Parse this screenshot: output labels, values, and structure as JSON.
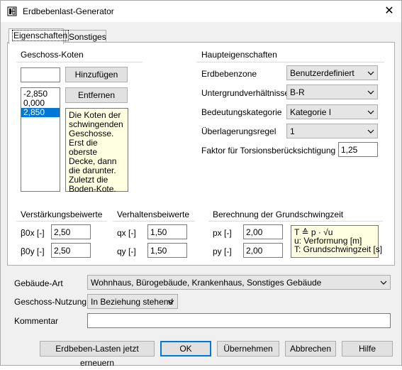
{
  "window": {
    "title": "Erdbebenlast-Generator",
    "close_glyph": "✕"
  },
  "tabs": [
    {
      "label": "Eigenschaften"
    },
    {
      "label": "Sonstiges"
    }
  ],
  "geschoss": {
    "title": "Geschoss-Koten",
    "input_value": "",
    "add_label": "Hinzufügen",
    "remove_label": "Entfernen",
    "items": [
      "-2,850",
      "0,000",
      "2,850"
    ],
    "selected_index": 2,
    "hint": "Die Koten der schwingenden Geschosse. Erst die oberste Decke, dann die darunter. Zuletzt die Boden-Kote."
  },
  "haupt": {
    "title": "Haupteigenschaften",
    "erdbebenzone": {
      "label": "Erdbebenzone",
      "value": "Benutzerdefiniert"
    },
    "untergrund": {
      "label": "Untergrundverhältnisse",
      "value": "B-R"
    },
    "bedeutung": {
      "label": "Bedeutungskategorie",
      "value": "Kategorie I"
    },
    "ueberlagerung": {
      "label": "Überlagerungsregel",
      "value": "1"
    },
    "torsion": {
      "label": "Faktor für Torsionsberücksichtigung [-]",
      "value": "1,25"
    }
  },
  "verstaerkung": {
    "title": "Verstärkungsbeiwerte",
    "b0x": {
      "label": "β0x [-]",
      "value": "2,50"
    },
    "b0y": {
      "label": "β0y [-]",
      "value": "2,50"
    }
  },
  "verhalten": {
    "title": "Verhaltensbeiwerte",
    "qx": {
      "label": "qx [-]",
      "value": "1,50"
    },
    "qy": {
      "label": "qy [-]",
      "value": "1,50"
    }
  },
  "grundschwingzeit": {
    "title": "Berechnung der Grundschwingzeit",
    "px": {
      "label": "px [-]",
      "value": "2,00"
    },
    "py": {
      "label": "py [-]",
      "value": "2,00"
    },
    "formula": "T ≙ p · √u",
    "line2": "u: Verformung [m]",
    "line3": "T: Grundschwingzeit [s]"
  },
  "gebaeude": {
    "label": "Gebäude-Art",
    "value": "Wohnhaus, Bürogebäude, Krankenhaus, Sonstiges Gebäude"
  },
  "nutzung": {
    "label": "Geschoss-Nutzung",
    "value": "In Beziehung stehend"
  },
  "kommentar": {
    "label": "Kommentar",
    "value": ""
  },
  "buttons": {
    "renew": "Erdbeben-Lasten jetzt erneuern",
    "ok": "OK",
    "apply": "Übernehmen",
    "cancel": "Abbrechen",
    "help": "Hilfe"
  },
  "colors": {
    "accent": "#0078d7",
    "tooltip_bg": "#ffffe1"
  },
  "icons": {
    "app": "load-generator-icon",
    "dropdown": "chevron-down-icon",
    "close": "close-icon"
  }
}
